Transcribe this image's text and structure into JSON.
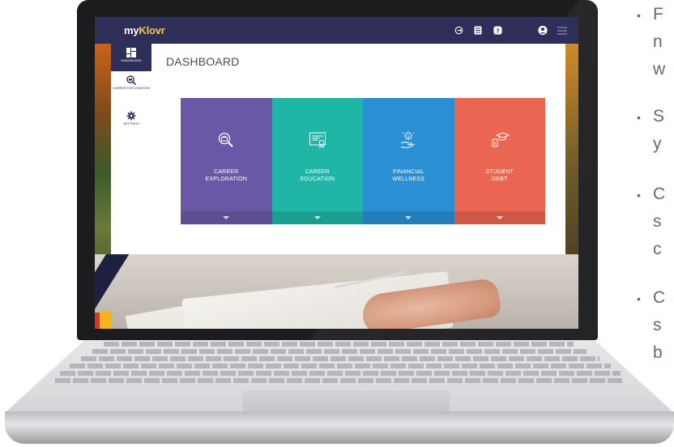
{
  "app": {
    "logo_prefix": "my",
    "logo_suffix": "Klovr",
    "topbar_icons": [
      "logout-icon",
      "notes-icon",
      "help-icon",
      "profile-icon",
      "menu-icon"
    ],
    "colors": {
      "topbar": "#2e2f58",
      "logo_accent": "#f5c84b"
    }
  },
  "sidebar": {
    "items": [
      {
        "label": "DASHBOARD",
        "icon": "dashboard-icon",
        "active": true
      },
      {
        "label": "CAREER EXPLORATION",
        "icon": "magnifier-briefcase-icon",
        "active": false
      },
      {
        "label": "SETTINGS",
        "icon": "gear-icon",
        "active": false
      }
    ]
  },
  "main": {
    "title": "DASHBOARD",
    "cards": [
      {
        "line1": "CAREER",
        "line2": "EXPLORATION",
        "icon": "magnifier-briefcase-icon",
        "color": "#6a58a6"
      },
      {
        "line1": "CAREER",
        "line2": "EDUCATION",
        "icon": "certificate-icon",
        "color": "#1fb6a7"
      },
      {
        "line1": "FINANCIAL",
        "line2": "WELLNESS",
        "icon": "money-hand-icon",
        "color": "#2a8fd3"
      },
      {
        "line1": "STUDENT",
        "line2": "DEBT",
        "icon": "graduation-cap-icon",
        "color": "#ea6552"
      }
    ]
  },
  "page_bullets": [
    {
      "text": "F"
    },
    {
      "text": "n"
    },
    {
      "text": "w"
    },
    {
      "text": "S"
    },
    {
      "text": "y"
    },
    {
      "text": "C"
    },
    {
      "text": "s"
    },
    {
      "text": "c"
    },
    {
      "text": "C"
    },
    {
      "text": "s"
    },
    {
      "text": "b"
    }
  ]
}
